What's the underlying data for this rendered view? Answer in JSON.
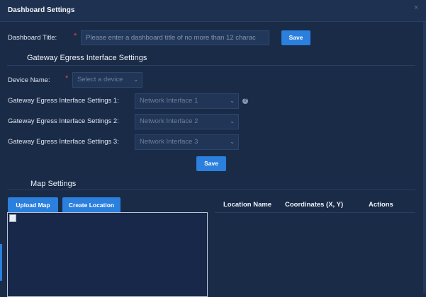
{
  "dialog": {
    "title": "Dashboard Settings",
    "close_glyph": "×"
  },
  "dashboard_title": {
    "label": "Dashboard Title:",
    "required_mark": "*",
    "placeholder": "Please enter a dashboard title of no more than 12 charac",
    "save_label": "Save"
  },
  "gateway_section": {
    "heading": "Gateway Egress Interface Settings",
    "device_label": "Device Name:",
    "required_mark": "*",
    "device_placeholder": "Select a device",
    "interfaces": [
      {
        "label": "Gateway Egress Interface Settings 1:",
        "placeholder": "Network Interface 1"
      },
      {
        "label": "Gateway Egress Interface Settings 2:",
        "placeholder": "Network Interface 2"
      },
      {
        "label": "Gateway Egress Interface Settings 3:",
        "placeholder": "Network Interface 3"
      }
    ],
    "help_glyph": "?",
    "save_label": "Save"
  },
  "map_section": {
    "heading": "Map Settings",
    "upload_label": "Upload Map",
    "create_location_label": "Create Location",
    "columns": [
      "Location Name",
      "Coordinates (X, Y)",
      "Actions"
    ]
  },
  "icons": {
    "caret": "chevron-down-icon",
    "close": "close-icon",
    "help": "question-circle-icon"
  },
  "colors": {
    "background": "#1a2b48",
    "accent": "#2b7fdd",
    "required": "#e0483f"
  }
}
